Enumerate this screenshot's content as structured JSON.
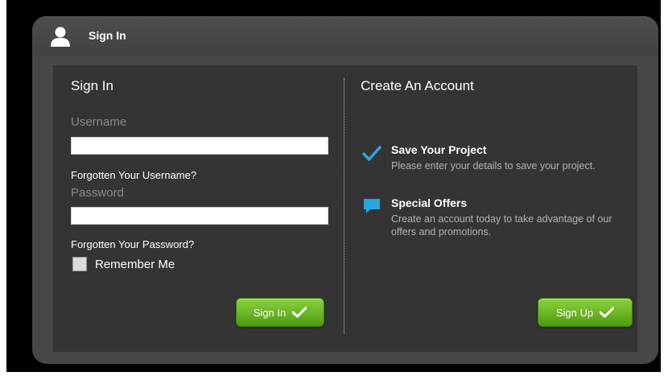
{
  "header": {
    "title": "Sign In",
    "icon": "user-icon"
  },
  "signin": {
    "title": "Sign In",
    "username_label": "Username",
    "username_value": "",
    "forgot_username": "Forgotten Your Username?",
    "password_label": "Password",
    "password_value": "",
    "forgot_password": "Forgotten Your Password?",
    "remember_label": "Remember Me",
    "remember_checked": false,
    "button_label": "Sign In"
  },
  "create": {
    "title": "Create An Account",
    "features": [
      {
        "icon": "checkmark-icon",
        "title": "Save Your Project",
        "desc": "Please enter your details to save your project."
      },
      {
        "icon": "speech-bubble-icon",
        "title": "Special Offers",
        "desc": "Create an account today to take advantage of our offers and promotions."
      }
    ],
    "button_label": "Sign Up"
  },
  "colors": {
    "panel": "#474747",
    "inner": "#343434",
    "accent_green": "#6cb82a",
    "accent_blue": "#2aa6e0"
  }
}
